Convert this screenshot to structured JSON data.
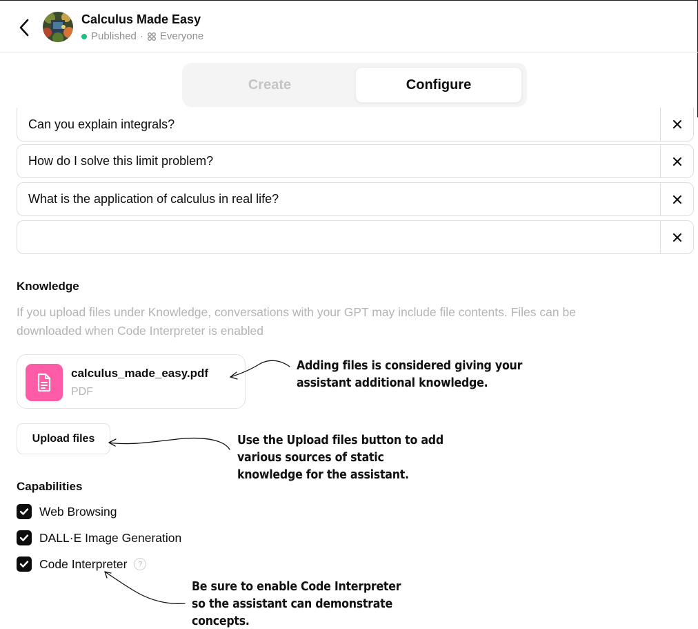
{
  "header": {
    "title": "Calculus Made Easy",
    "status": "Published",
    "separator": "·",
    "audience": "Everyone"
  },
  "tabs": {
    "create": "Create",
    "configure": "Configure",
    "active": "Configure"
  },
  "conversation_starters": [
    "Can you explain integrals?",
    "How do I solve this limit problem?",
    "What is the application of calculus in real life?",
    ""
  ],
  "knowledge": {
    "title": "Knowledge",
    "description_line1": "If you upload files under Knowledge, conversations with your GPT may include file contents. Files can be",
    "description_line2": "downloaded when Code Interpreter is enabled",
    "file": {
      "name": "calculus_made_easy.pdf",
      "type": "PDF",
      "icon": "document-icon",
      "icon_color": "#ff5ca8"
    },
    "upload_label": "Upload files"
  },
  "capabilities": {
    "title": "Capabilities",
    "items": [
      {
        "label": "Web Browsing",
        "checked": true
      },
      {
        "label": "DALL·E Image Generation",
        "checked": true
      },
      {
        "label": "Code Interpreter",
        "checked": true
      }
    ],
    "help_glyph": "?"
  },
  "annotations": {
    "file": [
      "Adding files is considered giving your",
      "assistant additional knowledge."
    ],
    "upload": [
      "Use the Upload files button to add",
      "various sources of static",
      "knowledge for the assistant."
    ],
    "code": [
      "Be sure to enable Code Interpreter",
      "so the assistant can demonstrate",
      "concepts."
    ]
  },
  "colors": {
    "status_dot": "#19c37d",
    "file_icon_bg": "#ff5ca8",
    "checkbox": "#0d0d0d"
  }
}
